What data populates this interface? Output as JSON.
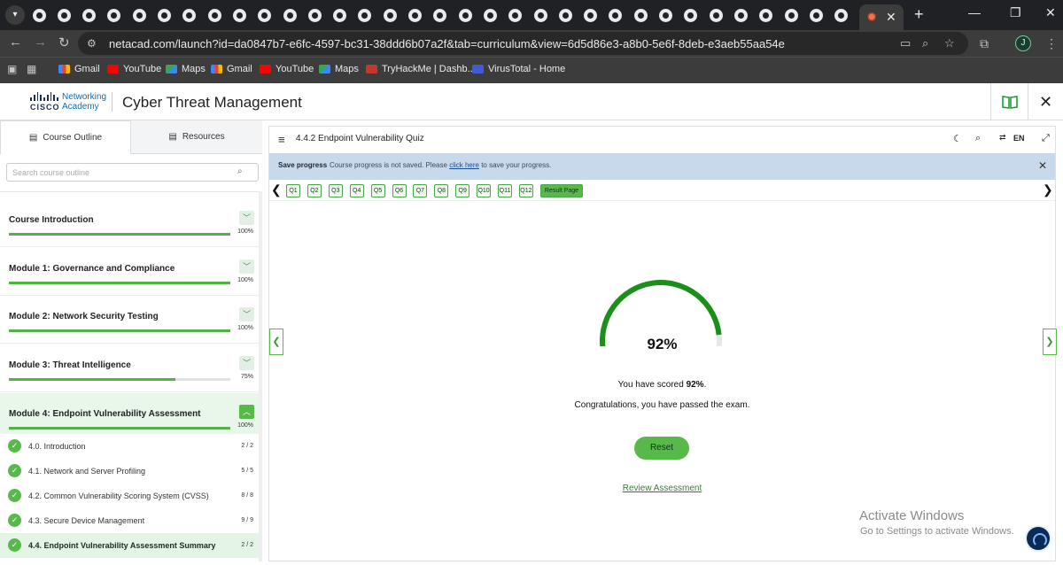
{
  "browser": {
    "url": "netacad.com/launch?id=da0847b7-e6fc-4597-bc31-38ddd6b07a2f&tab=curriculum&view=6d5d86e3-a8b0-5e6f-8deb-e3aeb55aa54e",
    "profile_initial": "J",
    "active_tab_icon": "star-burst-icon",
    "bookmarks": [
      "Gmail",
      "YouTube",
      "Maps",
      "Gmail",
      "YouTube",
      "Maps",
      "TryHackMe | Dashb...",
      "VirusTotal - Home"
    ]
  },
  "app": {
    "brand_line1": "Networking",
    "brand_line2": "Academy",
    "brand_word": "CISCO",
    "course_title": "Cyber Threat Management"
  },
  "sidebar": {
    "tabs": [
      "Course Outline",
      "Resources"
    ],
    "search_placeholder": "Search course outline",
    "modules": [
      {
        "name": "Course Introduction",
        "progress": "100%",
        "value": 100,
        "open": false
      },
      {
        "name": "Module 1: Governance and Compliance",
        "progress": "100%",
        "value": 100,
        "open": false
      },
      {
        "name": "Module 2: Network Security Testing",
        "progress": "100%",
        "value": 100,
        "open": false
      },
      {
        "name": "Module 3: Threat Intelligence",
        "progress": "75%",
        "value": 75,
        "open": false
      },
      {
        "name": "Module 4: Endpoint Vulnerability Assessment",
        "progress": "100%",
        "value": 100,
        "open": true
      }
    ],
    "sections": [
      {
        "name": "4.0. Introduction",
        "count": "2 / 2"
      },
      {
        "name": "4.1. Network and Server Profiling",
        "count": "5 / 5"
      },
      {
        "name": "4.2. Common Vulnerability Scoring System (CVSS)",
        "count": "8 / 8"
      },
      {
        "name": "4.3. Secure Device Management",
        "count": "9 / 9"
      },
      {
        "name": "4.4. Endpoint Vulnerability Assessment Summary",
        "count": "2 / 2"
      }
    ]
  },
  "main": {
    "quiz_title": "4.4.2 Endpoint Vulnerability Quiz",
    "language": "EN",
    "banner": {
      "title": "Save progress",
      "text_before": "Course progress is not saved. Please ",
      "link": "click here",
      "text_after": " to save your progress."
    },
    "questions": [
      "Q1",
      "Q2",
      "Q3",
      "Q4",
      "Q5",
      "Q6",
      "Q7",
      "Q8",
      "Q9",
      "Q10",
      "Q11",
      "Q12"
    ],
    "result_label": "Result Page",
    "score_value": 92,
    "score_display": "92%",
    "scored_prefix": "You have scored ",
    "scored_bold": "92%",
    "scored_suffix": ".",
    "congrats": "Congratulations, you have passed the exam.",
    "reset_label": "Reset",
    "review_label": "Review Assessment"
  },
  "os": {
    "watermark_title": "Activate Windows",
    "watermark_sub": "Go to Settings to activate Windows."
  },
  "colors": {
    "accent_green": "#58b94b",
    "gauge_green": "#1a8f1a",
    "gauge_track": "#e6e6e6",
    "banner_blue": "#c9d9ec"
  }
}
